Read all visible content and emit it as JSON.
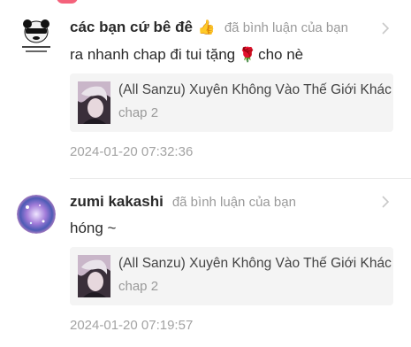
{
  "comments": [
    {
      "user": "các bạn cứ bê đê",
      "has_thumb_emoji": true,
      "thumb_emoji": "👍",
      "action": "đã bình luận của bạn",
      "text_before": "ra nhanh chap đi tui tặng",
      "rose_emoji": "🌹",
      "text_after": "cho nè",
      "card": {
        "title": "(All Sanzu) Xuyên Không Vào Thế Giới Khác",
        "chapter": "chap 2"
      },
      "time": "2024-01-20 07:32:36",
      "avatar_icon": "panda-meme-icon"
    },
    {
      "user": "zumi kakashi",
      "action": "đã bình luận của bạn",
      "text": "hóng ~",
      "card": {
        "title": "(All Sanzu) Xuyên Không Vào Thế Giới Khác",
        "chapter": "chap 2"
      },
      "time": "2024-01-20 07:19:57",
      "avatar_icon": "galaxy-avatar-icon"
    }
  ],
  "colors": {
    "accent_badge": "#f4627b",
    "card_bg": "#f4f4f4",
    "muted_text": "#9a9a9a"
  }
}
